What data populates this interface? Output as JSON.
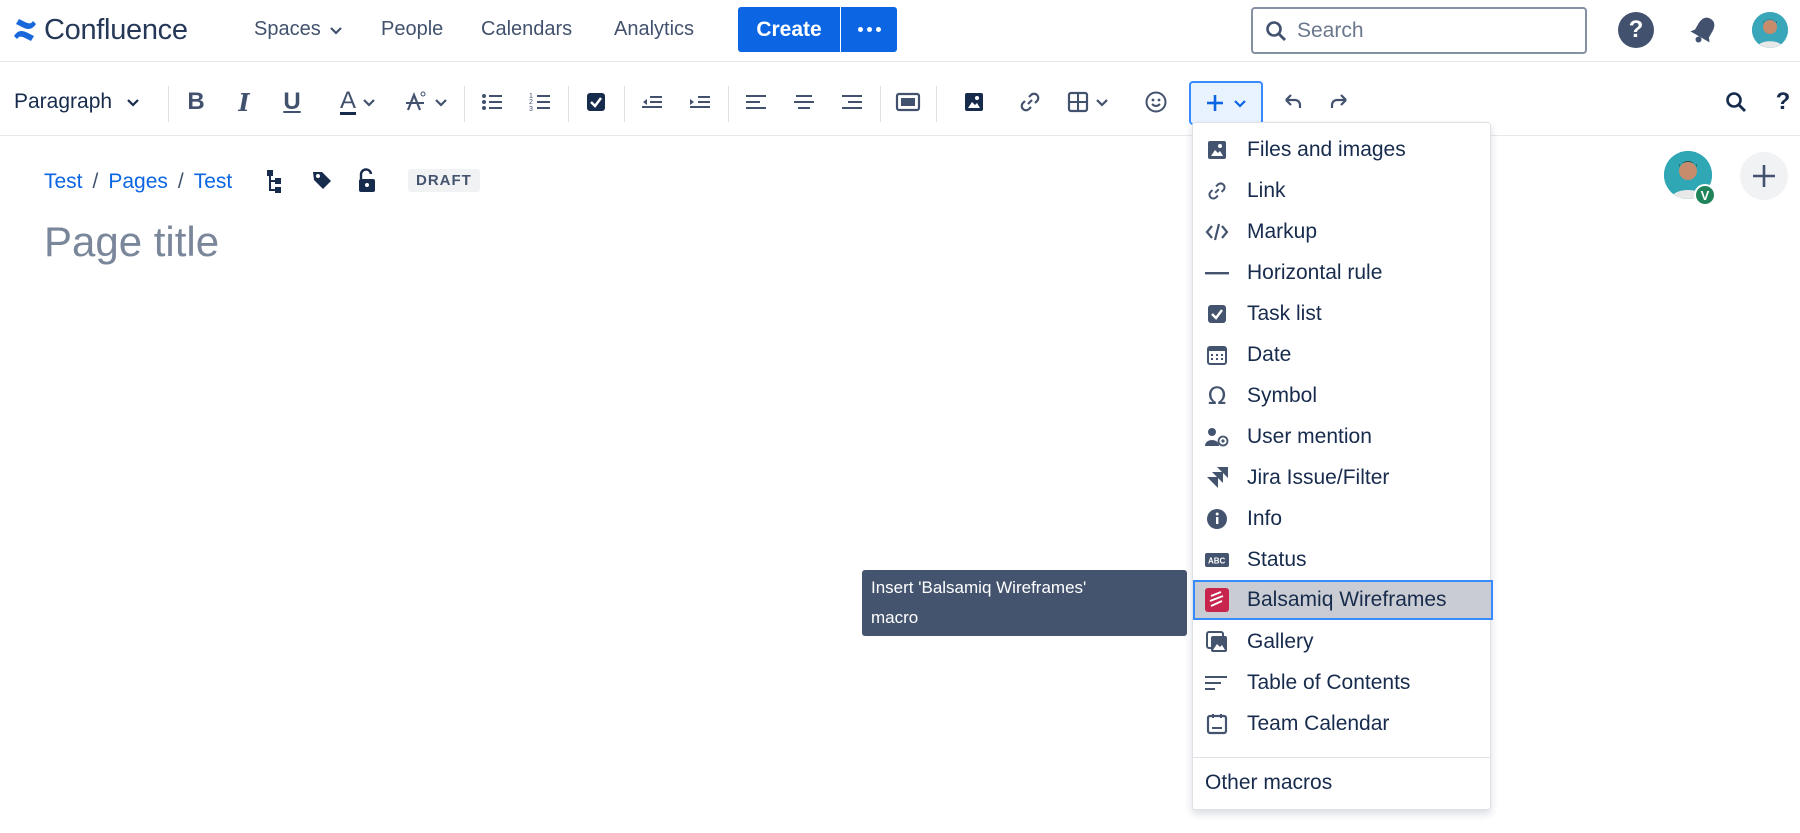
{
  "app": {
    "name": "Confluence",
    "brand_color": "#0c66e4"
  },
  "topnav": {
    "items": [
      {
        "label": "Spaces",
        "has_dropdown": true
      },
      {
        "label": "People"
      },
      {
        "label": "Calendars"
      },
      {
        "label": "Analytics"
      }
    ],
    "create_label": "Create",
    "search_placeholder": "Search"
  },
  "toolbar": {
    "paragraph_style": "Paragraph",
    "bold": "B",
    "italic": "I",
    "underline": "U",
    "text_color": "A"
  },
  "breadcrumb": {
    "items": [
      "Test",
      "Pages",
      "Test"
    ],
    "separator": "/"
  },
  "page": {
    "status": "DRAFT",
    "title_placeholder": "Page title"
  },
  "collaborator": {
    "badge": "V"
  },
  "insert_menu": {
    "items": [
      {
        "label": "Files and images",
        "icon": "image-icon"
      },
      {
        "label": "Link",
        "icon": "link-icon"
      },
      {
        "label": "Markup",
        "icon": "code-icon"
      },
      {
        "label": "Horizontal rule",
        "icon": "horizontal-rule-icon"
      },
      {
        "label": "Task list",
        "icon": "checkbox-icon"
      },
      {
        "label": "Date",
        "icon": "calendar-icon"
      },
      {
        "label": "Symbol",
        "icon": "omega-icon"
      },
      {
        "label": "User mention",
        "icon": "user-mention-icon"
      },
      {
        "label": "Jira Issue/Filter",
        "icon": "jira-icon"
      },
      {
        "label": "Info",
        "icon": "info-icon"
      },
      {
        "label": "Status",
        "icon": "status-icon"
      },
      {
        "label": "Balsamiq Wireframes",
        "icon": "balsamiq-icon",
        "active": true
      },
      {
        "label": "Gallery",
        "icon": "gallery-icon"
      },
      {
        "label": "Table of Contents",
        "icon": "toc-icon"
      },
      {
        "label": "Team Calendar",
        "icon": "team-calendar-icon"
      }
    ],
    "other_macros": "Other macros"
  },
  "tooltip": {
    "text_line1": "Insert 'Balsamiq Wireframes'",
    "text_line2": "macro"
  }
}
